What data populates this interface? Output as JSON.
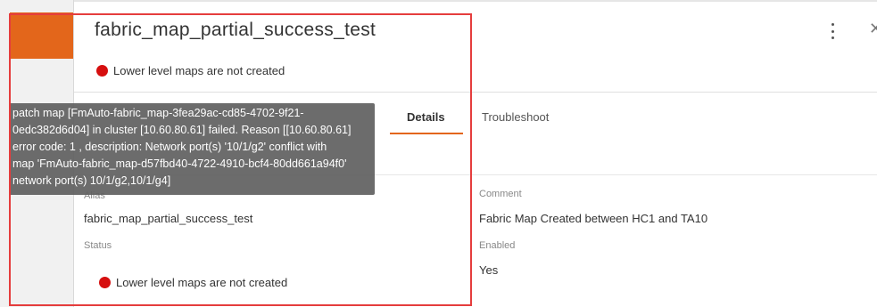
{
  "panel": {
    "title": "fabric_map_partial_success_test",
    "status_text": "Lower level maps are not created"
  },
  "tabs": [
    {
      "label": "Details",
      "active": true
    },
    {
      "label": "Troubleshoot",
      "active": false
    }
  ],
  "fields": {
    "alias": {
      "label": "Alias",
      "value": "fabric_map_partial_success_test"
    },
    "status": {
      "label": "Status",
      "value": "Lower level maps are not created"
    },
    "comment": {
      "label": "Comment",
      "value": "Fabric Map Created between HC1 and TA10"
    },
    "enabled": {
      "label": "Enabled",
      "value": "Yes"
    }
  },
  "tooltip": {
    "lines": [
      "patch map [FmAuto-fabric_map-3fea29ac-cd85-4702-9f21-",
      "0edc382d6d04] in cluster [10.60.80.61] failed. Reason [[10.60.80.61]",
      "error code: 1 , description: Network port(s) '10/1/g2' conflict with",
      "map 'FmAuto-fabric_map-d57fbd40-4722-4910-bcf4-80dd661a94f0'",
      "network port(s) 10/1/g2,10/1/g4]"
    ]
  },
  "icons": {
    "status": "red-dot-icon",
    "more": "kebab-menu-icon",
    "close": "close-icon"
  },
  "colors": {
    "accent": "#e3661b",
    "status_error": "#d60f0f",
    "highlight": "#e53d3d"
  }
}
